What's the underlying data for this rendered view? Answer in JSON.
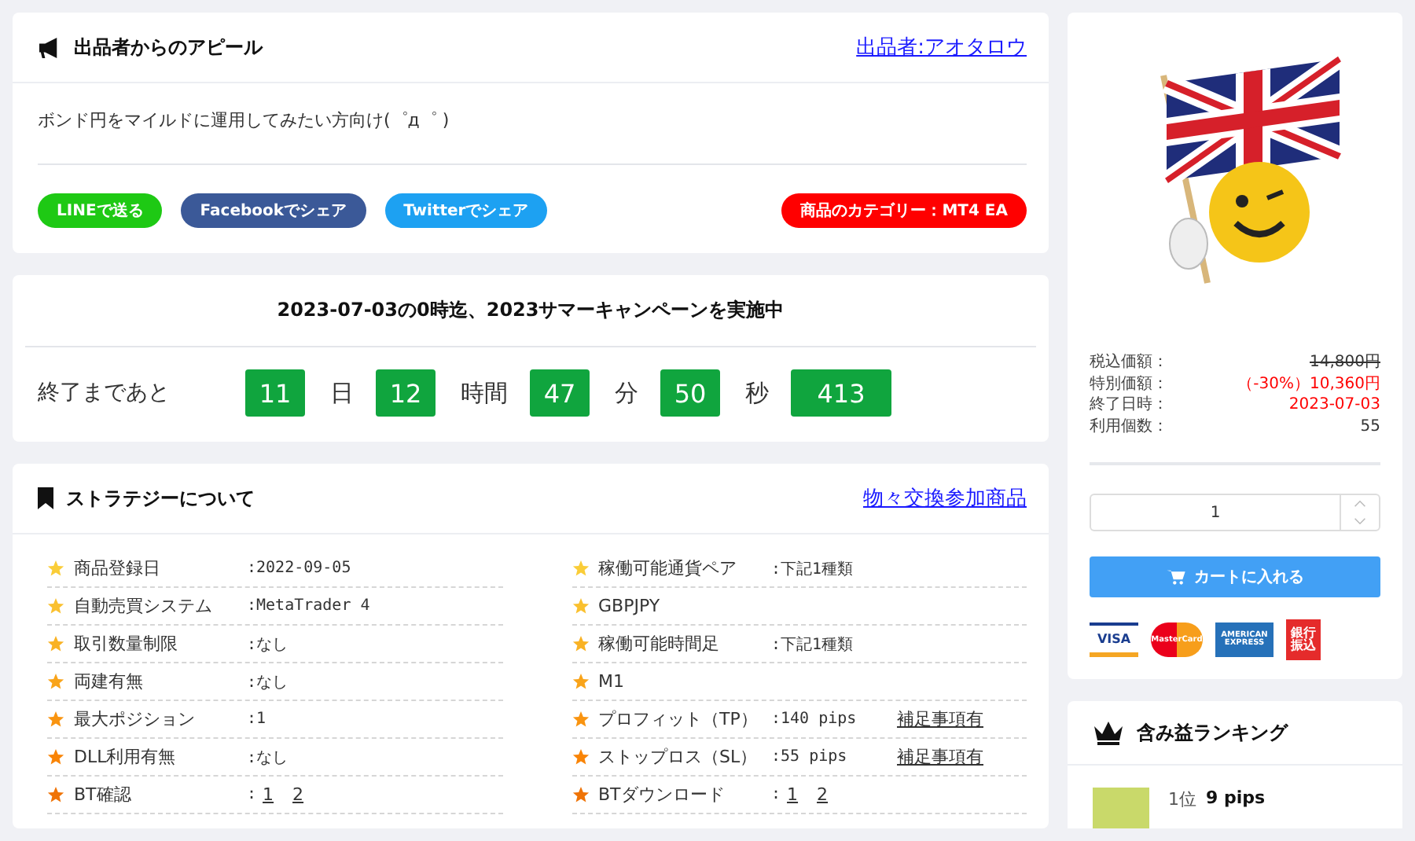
{
  "appeal": {
    "title": "出品者からのアピール",
    "seller_link": "出品者:アオタロウ",
    "message": "ボンド円をマイルドに運用してみたい方向け(゜д゜ )",
    "share_buttons": [
      {
        "kind": "line",
        "label": "LINEで送る"
      },
      {
        "kind": "facebook",
        "label": "Facebookでシェア"
      },
      {
        "kind": "twitter",
        "label": "Twitterでシェア"
      }
    ],
    "category": "商品のカテゴリー：MT4 EA"
  },
  "campaign": {
    "title": "2023-07-03の0時迄、2023サマーキャンペーンを実施中",
    "countdown_label": "終了まであと",
    "segments": [
      {
        "value": "11",
        "unit": "日"
      },
      {
        "value": "12",
        "unit": "時間"
      },
      {
        "value": "47",
        "unit": "分"
      },
      {
        "value": "50",
        "unit": "秒"
      },
      {
        "value": "413"
      }
    ]
  },
  "strategy": {
    "title": "ストラテジーについて",
    "link": "物々交換参加商品",
    "columns": [
      [
        {
          "label": "商品登録日",
          "value": ":2022-09-05"
        },
        {
          "label": "自動売買システム",
          "value": ":MetaTrader 4"
        },
        {
          "label": "取引数量制限",
          "value": ":なし"
        },
        {
          "label": "両建有無",
          "value": ":なし"
        },
        {
          "label": "最大ポジション",
          "value": ":1"
        },
        {
          "label": "DLL利用有無",
          "value": ":なし"
        },
        {
          "label": "BT確認",
          "value": ":",
          "links": [
            "1",
            "2"
          ]
        }
      ],
      [
        {
          "label": "稼働可能通貨ペア",
          "value": ":下記1種類"
        },
        {
          "label": "GBPJPY"
        },
        {
          "label": "稼働可能時間足",
          "value": ":下記1種類"
        },
        {
          "label": "M1"
        },
        {
          "label": "プロフィット（TP）",
          "value": ":140 pips",
          "note": "補足事項有"
        },
        {
          "label": "ストップロス（SL）",
          "value": ":55 pips",
          "note": "補足事項有"
        },
        {
          "label": "BTダウンロード",
          "value": ":",
          "links": [
            "1",
            "2"
          ]
        }
      ]
    ]
  },
  "product": {
    "prices": [
      {
        "label": "税込価額：",
        "value": "14,800円",
        "kind": "struck"
      },
      {
        "label": "特別価額：",
        "value": "（-30%）10,360円",
        "kind": "red"
      },
      {
        "label": "終了日時：",
        "value": "2023-07-03",
        "kind": "red"
      },
      {
        "label": "利用個数：",
        "value": "55",
        "kind": "plain"
      }
    ],
    "quantity": "1",
    "cart_button": "カートに入れる",
    "payments": [
      {
        "kind": "visa",
        "label": "VISA"
      },
      {
        "kind": "master",
        "label": "MasterCard"
      },
      {
        "kind": "amex",
        "label": "AMERICAN EXPRESS"
      },
      {
        "kind": "bank",
        "label": "銀行振込"
      }
    ]
  },
  "ranking": {
    "title": "含み益ランキング",
    "items": [
      {
        "rank": "1位",
        "value": "9 pips"
      }
    ]
  }
}
